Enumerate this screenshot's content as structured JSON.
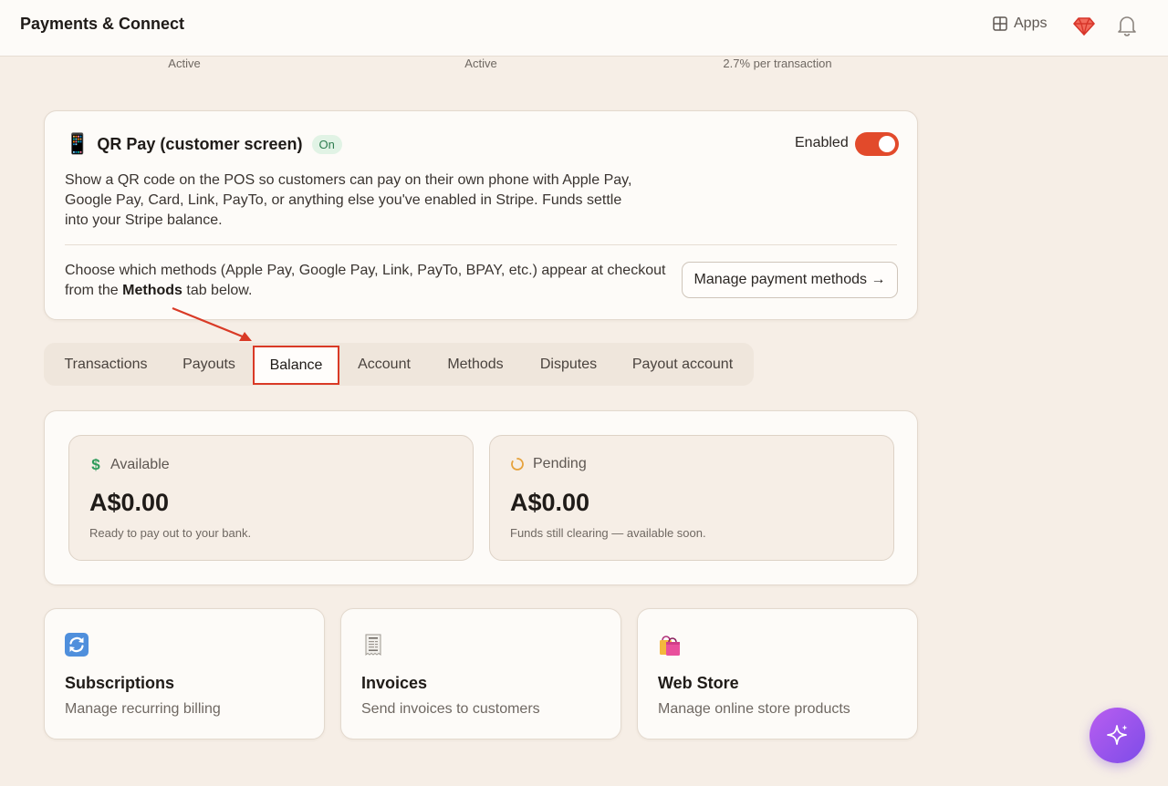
{
  "header": {
    "title": "Payments & Connect",
    "apps_label": "Apps"
  },
  "stats": [
    {
      "value": "Active"
    },
    {
      "value": "Active"
    },
    {
      "value": "2.7% per transaction"
    }
  ],
  "qr_pay": {
    "title": "QR Pay (customer screen)",
    "badge": "On",
    "enabled_label": "Enabled",
    "enabled": true,
    "description": "Show a QR code on the POS so customers can pay on their own phone with Apple Pay, Google Pay, Card, Link, PayTo, or anything else you've enabled in Stripe. Funds settle into your Stripe balance.",
    "note_prefix": "Choose which methods (Apple Pay, Google Pay, Link, PayTo, BPAY, etc.) appear at checkout from the ",
    "note_bold": "Methods",
    "note_suffix": " tab below.",
    "manage_button": "Manage payment methods →"
  },
  "tabs": [
    {
      "label": "Transactions"
    },
    {
      "label": "Payouts"
    },
    {
      "label": "Balance"
    },
    {
      "label": "Account"
    },
    {
      "label": "Methods"
    },
    {
      "label": "Disputes"
    },
    {
      "label": "Payout account"
    }
  ],
  "active_tab": "Balance",
  "balance": {
    "available": {
      "label": "Available",
      "amount": "A$0.00",
      "sub": "Ready to pay out to your bank."
    },
    "pending": {
      "label": "Pending",
      "amount": "A$0.00",
      "sub": "Funds still clearing — available soon."
    }
  },
  "features": [
    {
      "title": "Subscriptions",
      "sub": "Manage recurring billing",
      "icon": "refresh-icon"
    },
    {
      "title": "Invoices",
      "sub": "Send invoices to customers",
      "icon": "receipt-icon"
    },
    {
      "title": "Web Store",
      "sub": "Manage online store products",
      "icon": "shopping-bags-icon"
    }
  ],
  "colors": {
    "accent": "#e24a2b",
    "background": "#f6eee6",
    "fab_start": "#b95ef0",
    "fab_end": "#7d4ce8"
  }
}
